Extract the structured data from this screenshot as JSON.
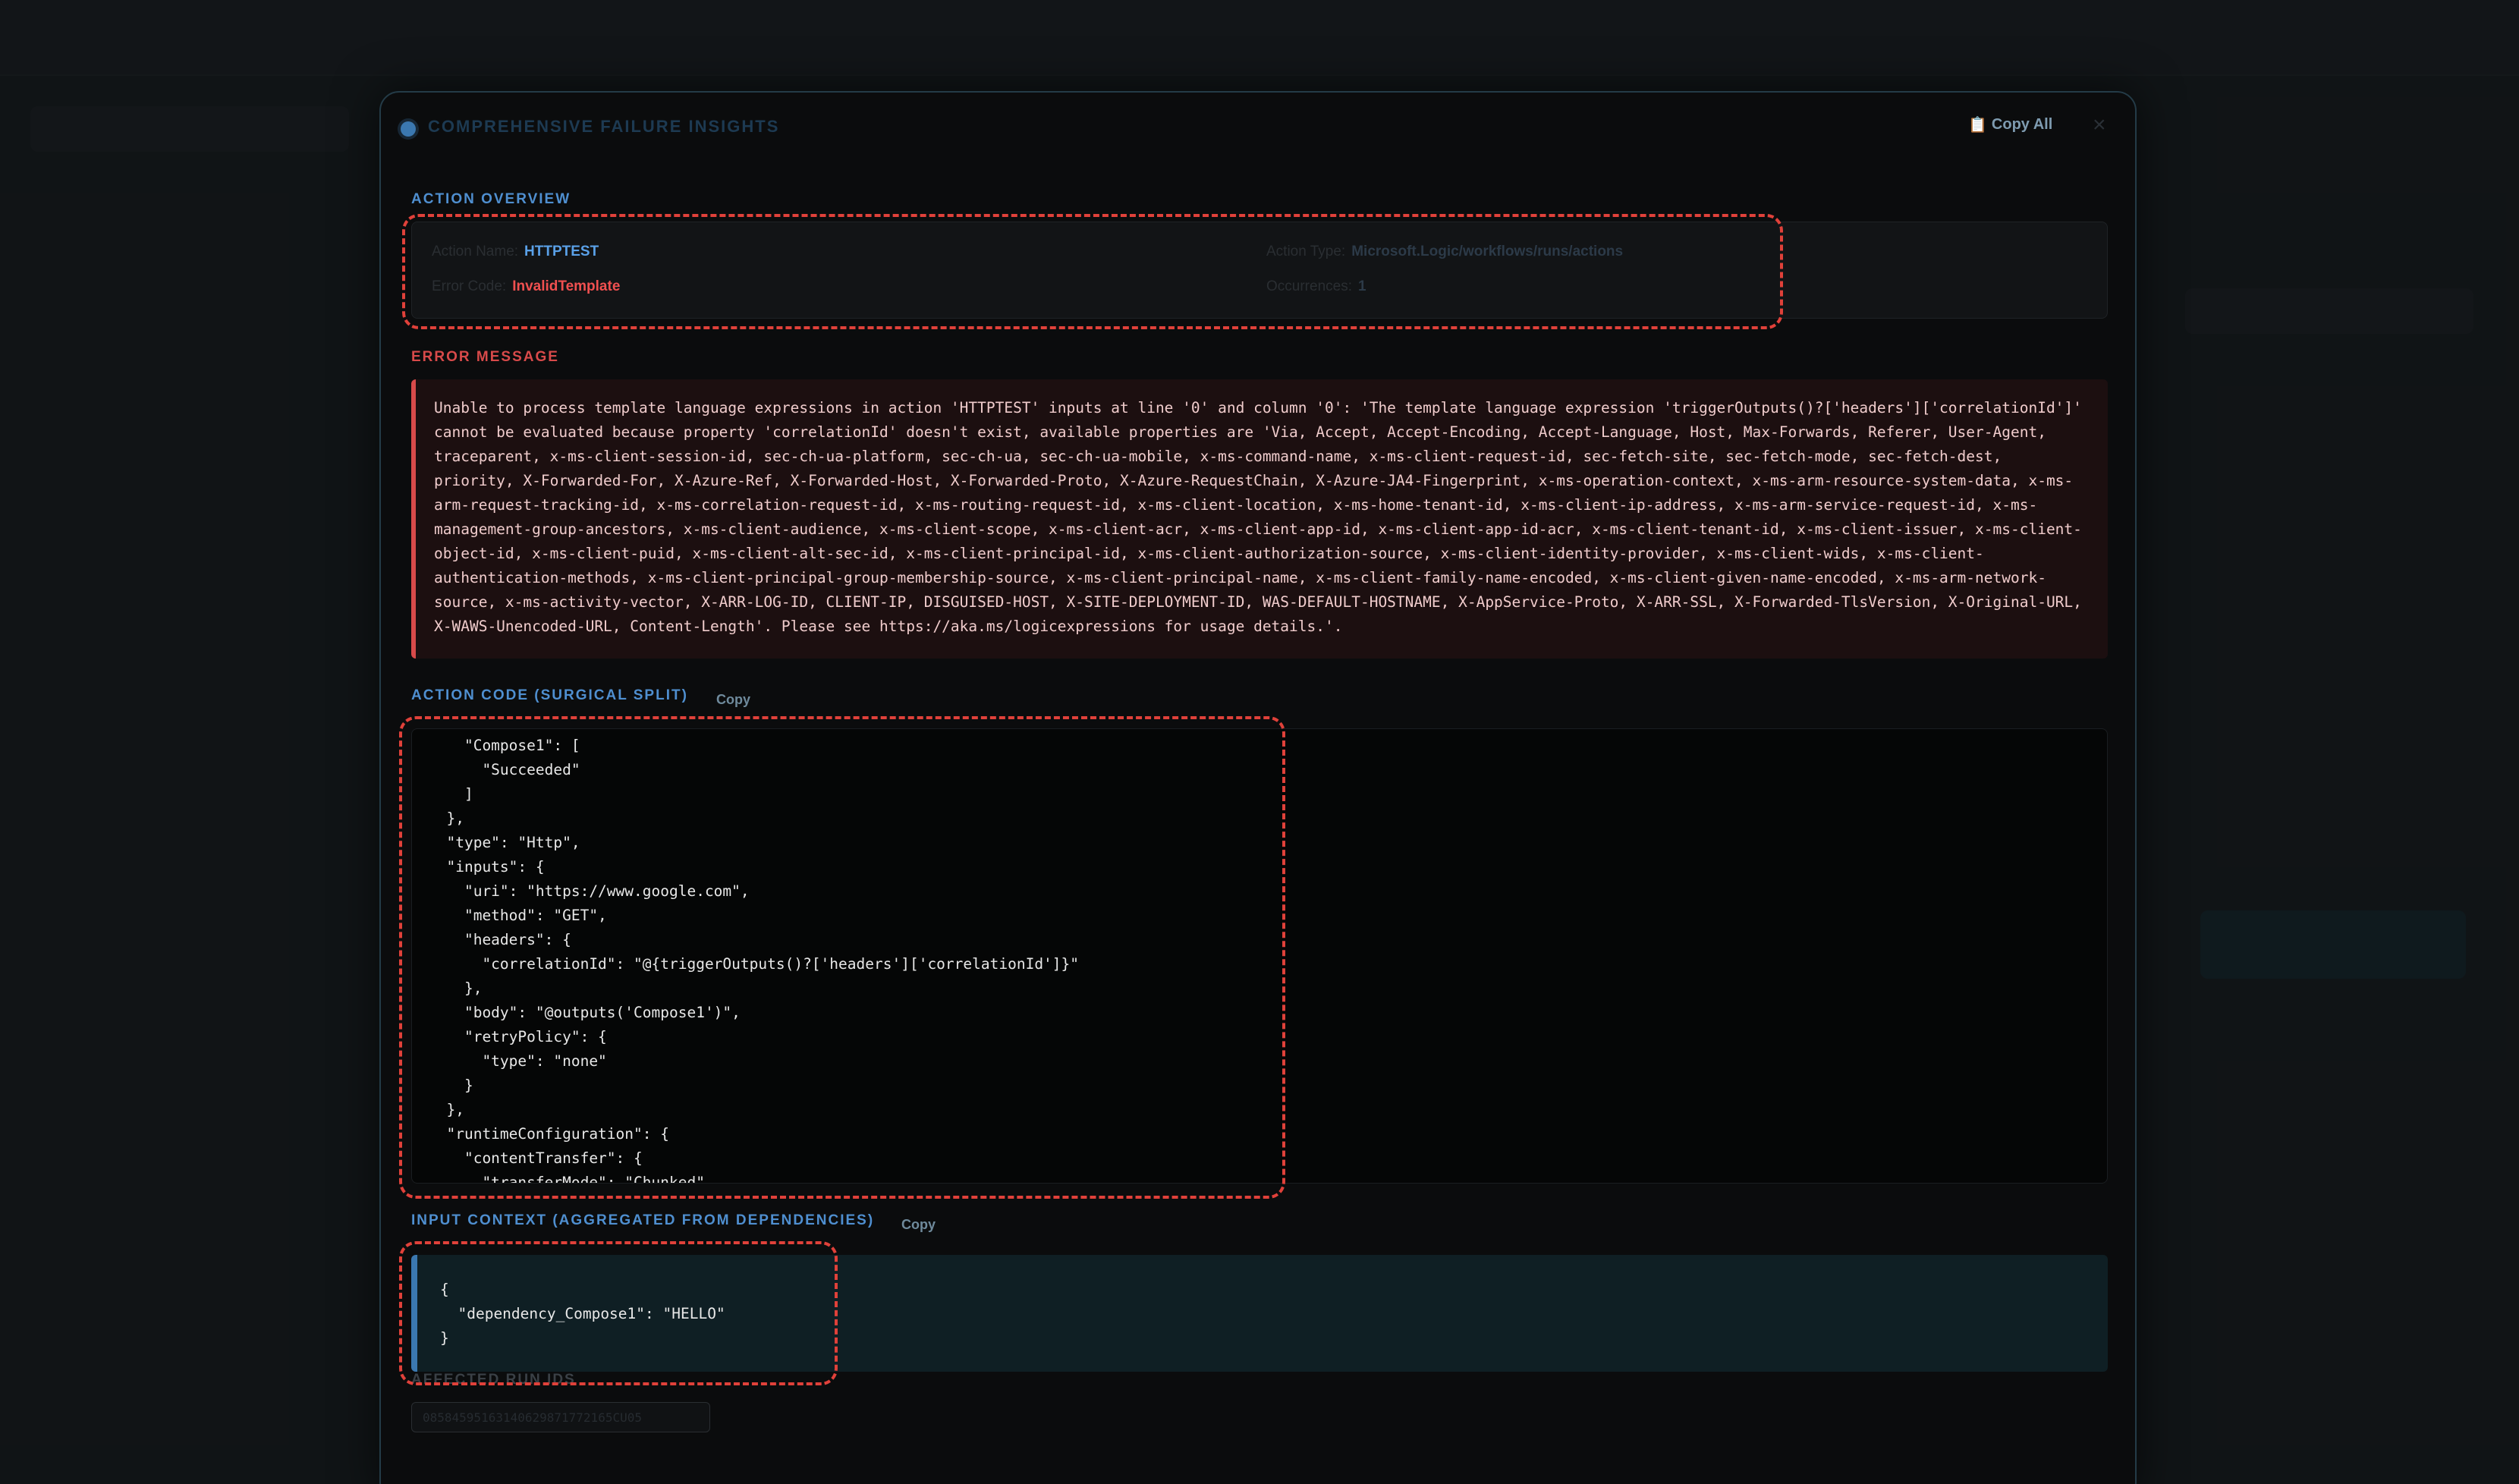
{
  "modal": {
    "title": "Comprehensive Failure Insights",
    "copy_all_label": "Copy All",
    "close_glyph": "×"
  },
  "overview": {
    "section_label": "Action Overview",
    "action_name_key": "Action Name:",
    "action_name": "HTTPTEST",
    "action_type_key": "Action Type:",
    "action_type": "Microsoft.Logic/workflows/runs/actions",
    "error_code_key": "Error Code:",
    "error_code": "InvalidTemplate",
    "occurrences_key": "Occurrences:",
    "occurrences": "1"
  },
  "error": {
    "section_label": "Error Message",
    "message": "Unable to process template language expressions in action 'HTTPTEST' inputs at line '0' and column '0': 'The template language expression 'triggerOutputs()?['headers']['correlationId']' cannot be evaluated because property 'correlationId' doesn't exist, available properties are 'Via, Accept, Accept-Encoding, Accept-Language, Host, Max-Forwards, Referer, User-Agent, traceparent, x-ms-client-session-id, sec-ch-ua-platform, sec-ch-ua, sec-ch-ua-mobile, x-ms-command-name, x-ms-client-request-id, sec-fetch-site, sec-fetch-mode, sec-fetch-dest, priority, X-Forwarded-For, X-Azure-Ref, X-Forwarded-Host, X-Forwarded-Proto, X-Azure-RequestChain, X-Azure-JA4-Fingerprint, x-ms-operation-context, x-ms-arm-resource-system-data, x-ms-arm-request-tracking-id, x-ms-correlation-request-id, x-ms-routing-request-id, x-ms-client-location, x-ms-home-tenant-id, x-ms-client-ip-address, x-ms-arm-service-request-id, x-ms-management-group-ancestors, x-ms-client-audience, x-ms-client-scope, x-ms-client-acr, x-ms-client-app-id, x-ms-client-app-id-acr, x-ms-client-tenant-id, x-ms-client-issuer, x-ms-client-object-id, x-ms-client-puid, x-ms-client-alt-sec-id, x-ms-client-principal-id, x-ms-client-authorization-source, x-ms-client-identity-provider, x-ms-client-wids, x-ms-client-authentication-methods, x-ms-client-principal-group-membership-source, x-ms-client-principal-name, x-ms-client-family-name-encoded, x-ms-client-given-name-encoded, x-ms-arm-network-source, x-ms-activity-vector, X-ARR-LOG-ID, CLIENT-IP, DISGUISED-HOST, X-SITE-DEPLOYMENT-ID, WAS-DEFAULT-HOSTNAME, X-AppService-Proto, X-ARR-SSL, X-Forwarded-TlsVersion, X-Original-URL, X-WAWS-Unencoded-URL, Content-Length'. Please see https://aka.ms/logicexpressions for usage details.'."
  },
  "action_code": {
    "section_label": "Action Code (Surgical Split)",
    "copy_label": "Copy",
    "code": "    \"Compose1\": [\n      \"Succeeded\"\n    ]\n  },\n  \"type\": \"Http\",\n  \"inputs\": {\n    \"uri\": \"https://www.google.com\",\n    \"method\": \"GET\",\n    \"headers\": {\n      \"correlationId\": \"@{triggerOutputs()?['headers']['correlationId']}\"\n    },\n    \"body\": \"@outputs('Compose1')\",\n    \"retryPolicy\": {\n      \"type\": \"none\"\n    }\n  },\n  \"runtimeConfiguration\": {\n    \"contentTransfer\": {\n      \"transferMode\": \"Chunked\""
  },
  "input_context": {
    "section_label": "Input Context (Aggregated from Dependencies)",
    "copy_label": "Copy",
    "code": "{\n  \"dependency_Compose1\": \"HELLO\"\n}"
  },
  "affected_runs": {
    "section_label": "Affected Run IDs",
    "run_id": "08584595163140629871772165CU05"
  },
  "colors": {
    "accent_blue": "#4f8fd0",
    "error_red": "#d84a4a",
    "annotation_red": "#e0413a"
  }
}
